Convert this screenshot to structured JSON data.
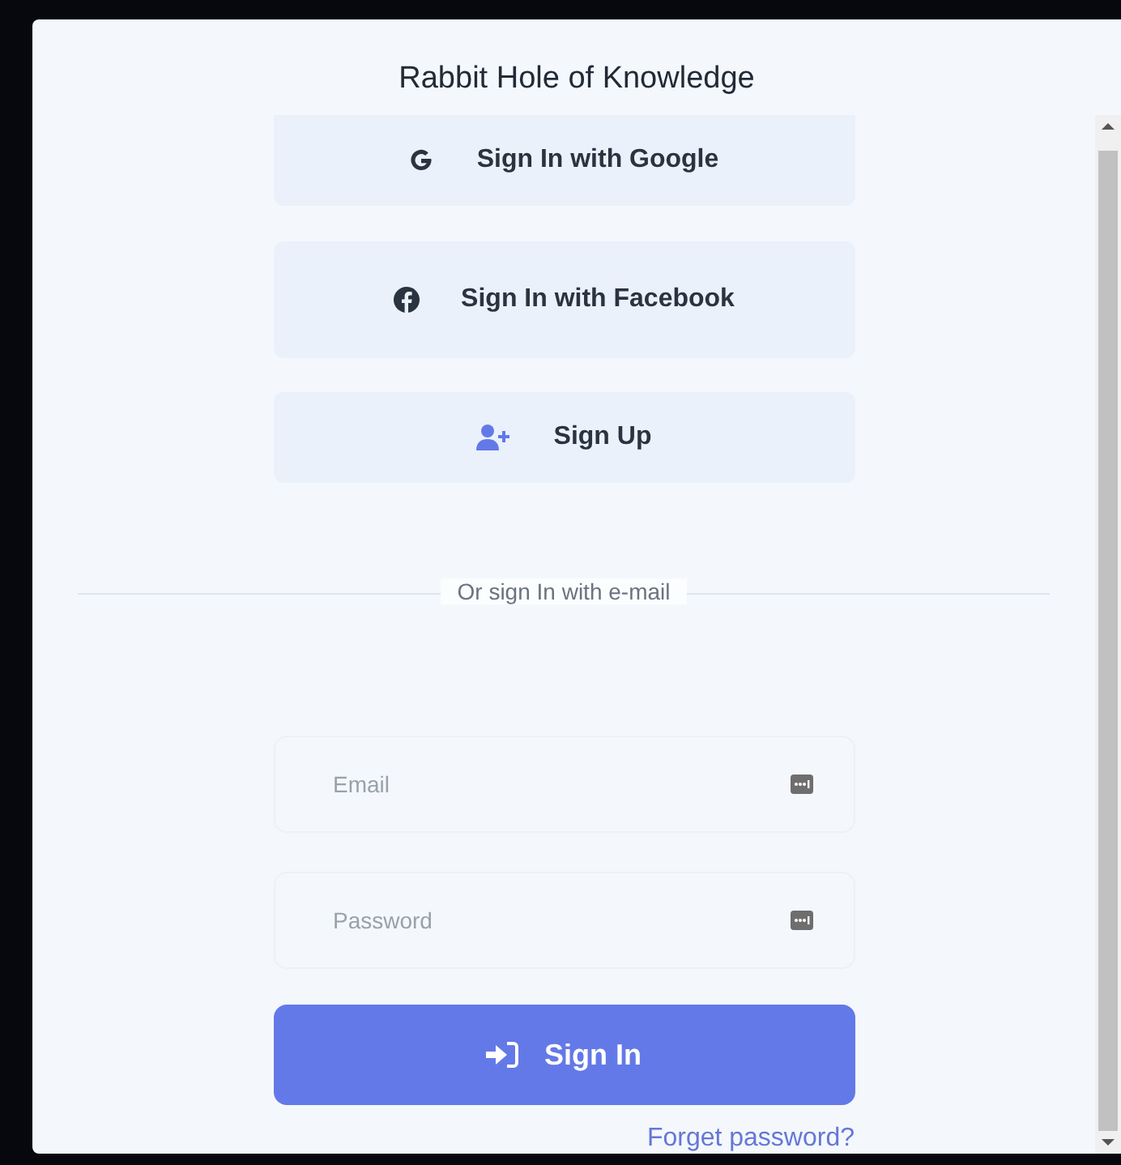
{
  "dialog": {
    "title": "Rabbit Hole of Knowledge"
  },
  "social_buttons": [
    {
      "kind": "google",
      "label": "Sign In with Google"
    },
    {
      "kind": "facebook",
      "label": "Sign In with Facebook"
    },
    {
      "kind": "signup",
      "label": "Sign Up"
    }
  ],
  "divider": {
    "label": "Or sign In with e-mail"
  },
  "fields": [
    {
      "placeholder": "Email"
    },
    {
      "placeholder": "Password"
    }
  ],
  "sign_in_button": {
    "label": "Sign In"
  },
  "forgot_link": {
    "label": "Forget password?"
  }
}
